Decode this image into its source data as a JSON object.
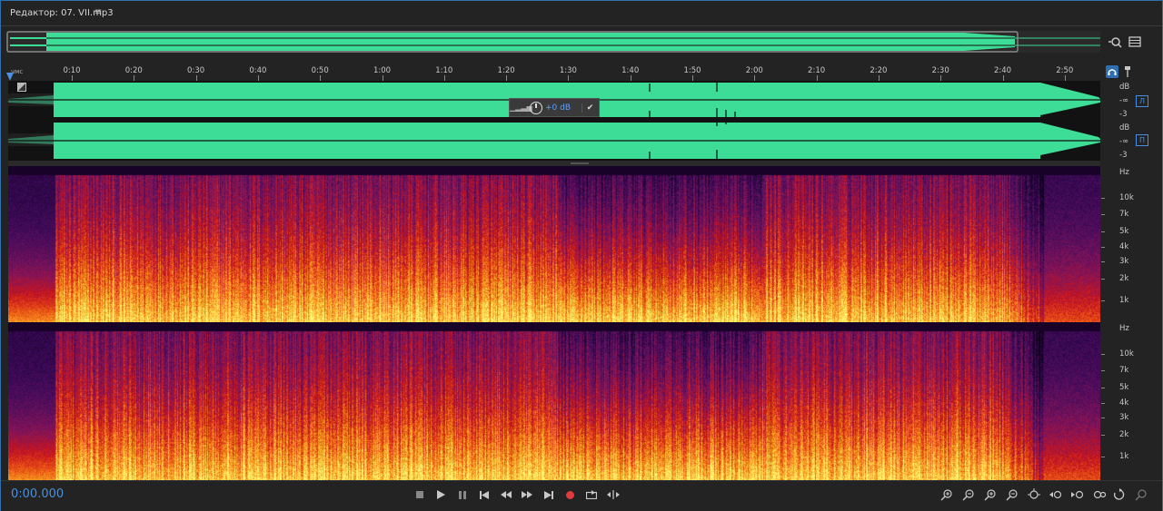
{
  "editor": {
    "title": "Редактор: 07. VII.mp3",
    "menu_glyph": "≡"
  },
  "ruler": {
    "unit": "чмс",
    "labels": [
      "0:10",
      "0:20",
      "0:30",
      "0:40",
      "0:50",
      "1:00",
      "1:10",
      "1:20",
      "1:30",
      "1:40",
      "1:50",
      "2:00",
      "2:10",
      "2:20",
      "2:30",
      "2:40",
      "2:50"
    ]
  },
  "amplitude_hud": {
    "value": "+0 dB"
  },
  "waveform": {
    "color": "#3ddc97",
    "db_unit": "dB",
    "left_channel": {
      "button": "Л",
      "labels": [
        "dB",
        "-∞",
        "-3"
      ]
    },
    "right_channel": {
      "button": "П",
      "labels": [
        "dB",
        "-∞",
        "-3"
      ]
    }
  },
  "spectral": {
    "unit": "Hz",
    "labels": [
      "10k",
      "7k",
      "5k",
      "4k",
      "3k",
      "2k",
      "1k"
    ]
  },
  "transport": {
    "time": "0:00.000",
    "record_color": "#e03b3b"
  },
  "icons": {
    "overview_zoom": "zoom-navigator-icon",
    "overview_list": "list-icon",
    "ruler_snap": "headphones-icon",
    "ruler_marker": "marker-icon"
  }
}
